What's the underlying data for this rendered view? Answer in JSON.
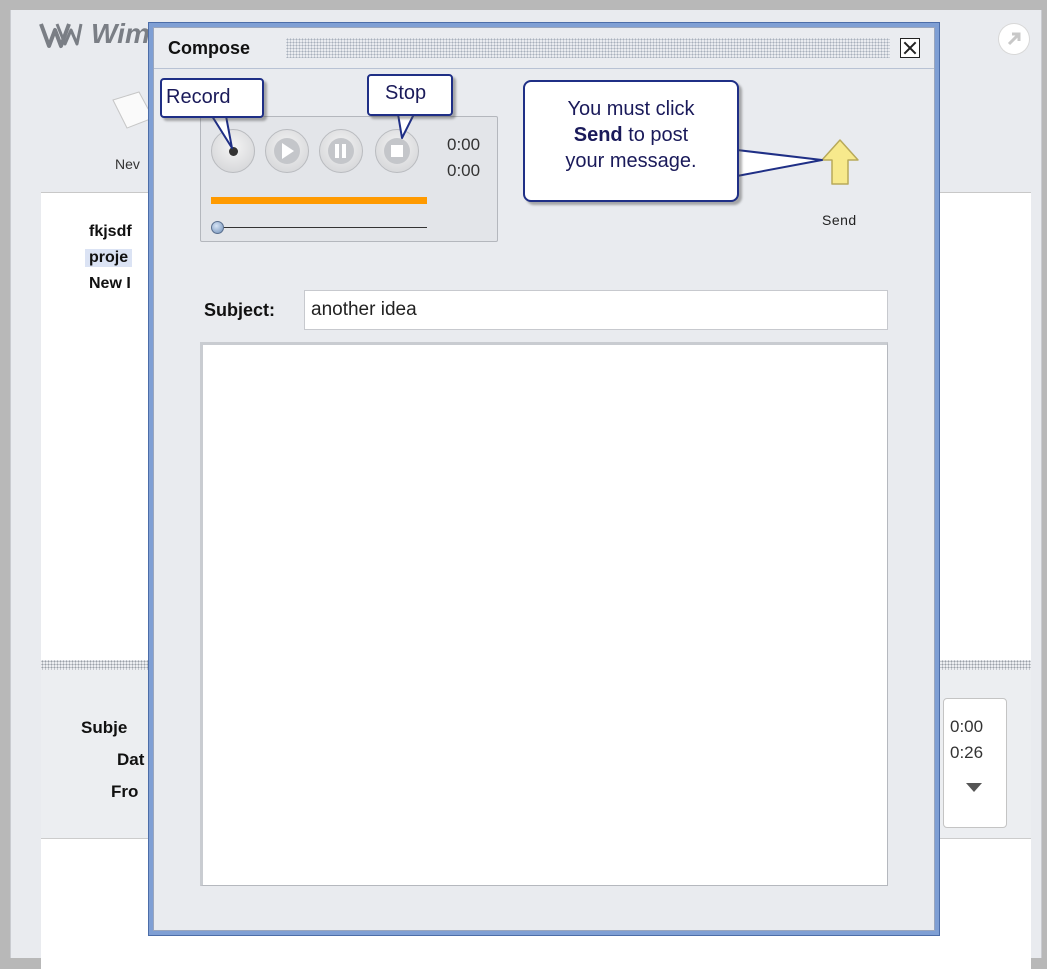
{
  "app": {
    "title": "Wim",
    "new_label": "Nev",
    "list_items": [
      "fkjsdf",
      "proje",
      "New I"
    ],
    "detail_labels": [
      "Subje",
      "Dat",
      "Fro"
    ],
    "mini_player_times": [
      "0:00",
      "0:26"
    ]
  },
  "dialog": {
    "title": "Compose",
    "recorder": {
      "elapsed": "0:00",
      "total": "0:00"
    },
    "send_label": "Send",
    "subject_label": "Subject:",
    "subject_value": "another idea",
    "body_value": ""
  },
  "callouts": {
    "record": "Record",
    "stop": "Stop",
    "send_line1": "You must click",
    "send_bold": "Send",
    "send_line2_rest": " to post",
    "send_line3": "your message."
  },
  "colors": {
    "dialog_frame": "#7f9fd4",
    "progress": "#ff9a00",
    "callout_border": "#1f2f86",
    "send_arrow": "#f7e98c"
  }
}
